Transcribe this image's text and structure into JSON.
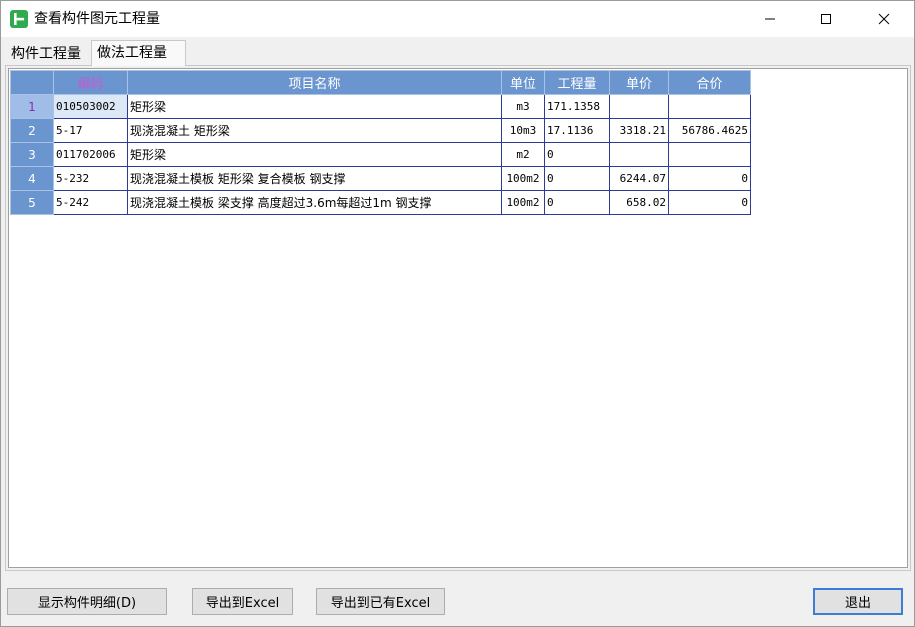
{
  "window": {
    "title": "查看构件图元工程量",
    "icon": "app-logo-icon",
    "controls": [
      "minimize-icon",
      "maximize-icon",
      "close-icon"
    ]
  },
  "tabs": [
    {
      "label": "构件工程量",
      "active": false
    },
    {
      "label": "做法工程量",
      "active": true
    }
  ],
  "table": {
    "headers": {
      "code": "编码",
      "name": "项目名称",
      "unit": "单位",
      "quantity": "工程量",
      "price": "单价",
      "total": "合价"
    },
    "rows": [
      {
        "num": "1",
        "code": "010503002",
        "name": "矩形梁",
        "unit": "m3",
        "quantity": "171.1358",
        "price": "",
        "total": ""
      },
      {
        "num": "2",
        "code": "5-17",
        "name": "现浇混凝土 矩形梁",
        "unit": "10m3",
        "quantity": "17.1136",
        "price": "3318.21",
        "total": "56786.4625"
      },
      {
        "num": "3",
        "code": "011702006",
        "name": "矩形梁",
        "unit": "m2",
        "quantity": "0",
        "price": "",
        "total": ""
      },
      {
        "num": "4",
        "code": "5-232",
        "name": "现浇混凝土模板 矩形梁 复合模板 钢支撑",
        "unit": "100m2",
        "quantity": "0",
        "price": "6244.07",
        "total": "0"
      },
      {
        "num": "5",
        "code": "5-242",
        "name": "现浇混凝土模板 梁支撑 高度超过3.6m每超过1m 钢支撑",
        "unit": "100m2",
        "quantity": "0",
        "price": "658.02",
        "total": "0"
      }
    ]
  },
  "buttons": {
    "show_detail": "显示构件明细(D)",
    "export_excel": "导出到Excel",
    "export_existing": "导出到已有Excel",
    "exit": "退出"
  },
  "colors": {
    "header_bg": "#6b95cf",
    "grid_border": "#2b3b9a",
    "accent_green": "#2faa4f"
  }
}
